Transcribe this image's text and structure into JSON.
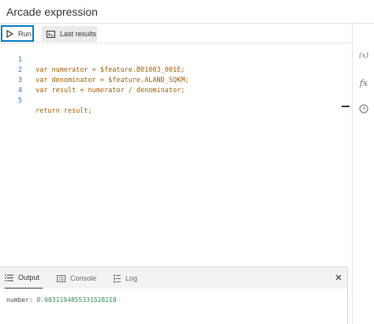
{
  "header": {
    "title": "Arcade expression"
  },
  "toolbar": {
    "run_label": "Run",
    "last_results_label": "Last results"
  },
  "editor": {
    "lines": [
      {
        "number": "1",
        "code": "var numerator = $feature.B01003_001E;"
      },
      {
        "number": "2",
        "code": "var denominator = $feature.ALAND_SQKM;"
      },
      {
        "number": "3",
        "code": "var result = numerator / denominator;"
      },
      {
        "number": "4",
        "code": ""
      },
      {
        "number": "5",
        "code": "return result;"
      }
    ]
  },
  "right_sidebar": {
    "items": [
      {
        "label": "(x)",
        "icon": "variables-icon"
      },
      {
        "label": "fx",
        "icon": "functions-icon"
      },
      {
        "label": "?",
        "icon": "help-icon"
      }
    ]
  },
  "bottom_panel": {
    "tabs": [
      {
        "label": "Output",
        "icon": "output-icon"
      },
      {
        "label": "Console",
        "icon": "console-icon"
      },
      {
        "label": "Log",
        "icon": "log-icon"
      }
    ],
    "output_type": "number:",
    "output_value": "0.0031194855331528218"
  }
}
